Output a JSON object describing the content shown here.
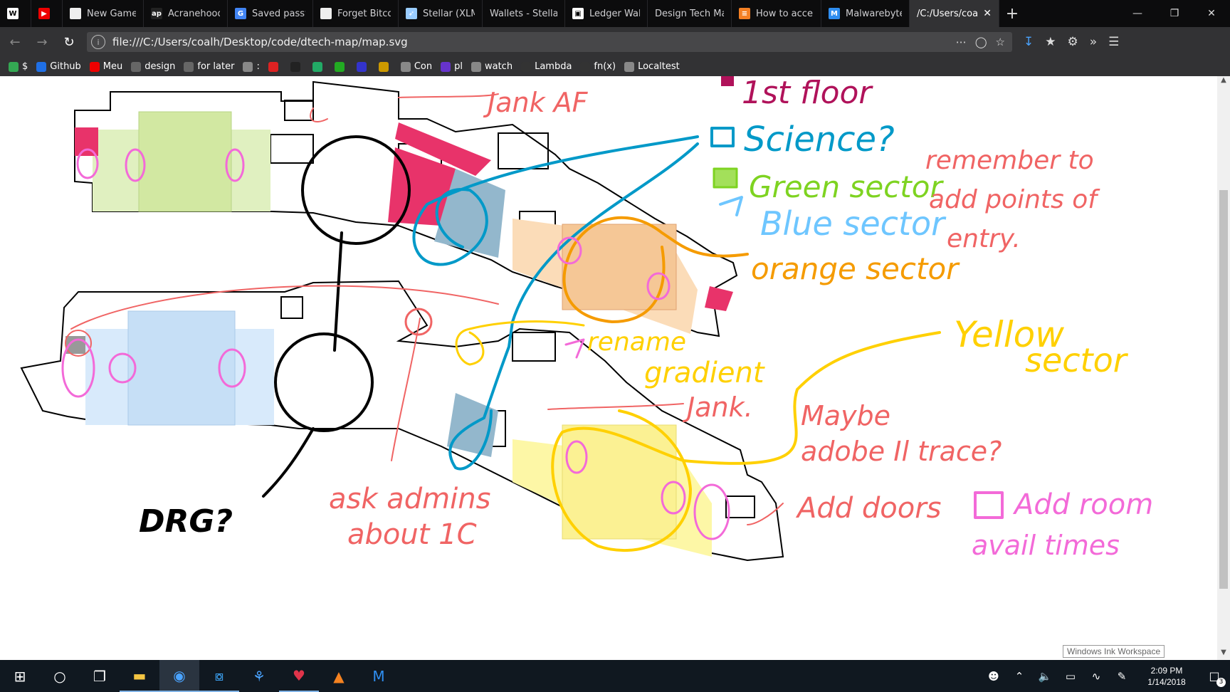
{
  "tabs": [
    {
      "label": "",
      "icon": "wikipedia-icon",
      "width": 44
    },
    {
      "label": "",
      "icon": "youtube-icon",
      "width": 44
    },
    {
      "label": "New Gamell",
      "icon": "page-icon",
      "width": 114
    },
    {
      "label": "Acranehood'",
      "icon": "ap-icon",
      "width": 118
    },
    {
      "label": "Saved passw",
      "icon": "google-icon",
      "width": 120
    },
    {
      "label": "Forget Bitcoi",
      "icon": "page-icon",
      "width": 120
    },
    {
      "label": "Stellar (XLM)",
      "icon": "rocket-icon",
      "width": 118
    },
    {
      "label": "Wallets - Stellar",
      "icon": "",
      "width": 116
    },
    {
      "label": "Ledger Walle",
      "icon": "ledger-icon",
      "width": 116
    },
    {
      "label": "Design Tech Map",
      "icon": "",
      "width": 118
    },
    {
      "label": "How to acce",
      "icon": "stackoverflow-icon",
      "width": 126
    },
    {
      "label": "Malwarebyte",
      "icon": "malwarebytes-icon",
      "width": 124
    },
    {
      "label": "/C:/Users/coal",
      "icon": "",
      "width": 126,
      "active": true
    }
  ],
  "window_controls": {
    "minimize": "—",
    "restore": "❐",
    "close": "✕"
  },
  "navbar": {
    "url": "file:///C:/Users/coalh/Desktop/code/dtech-map/map.svg",
    "info_glyph": "i"
  },
  "bookmarks": [
    {
      "label": "$",
      "icon": "drive-icon",
      "color": "#34a853"
    },
    {
      "label": "Github",
      "icon": "firefox-icon",
      "color": "#1f6fe5"
    },
    {
      "label": "Meu",
      "icon": "youtube-icon",
      "color": "#e00"
    },
    {
      "label": "design",
      "icon": "folder-icon",
      "color": "#666"
    },
    {
      "label": "for later",
      "icon": "folder-icon",
      "color": "#666"
    },
    {
      "label": ":",
      "icon": "globe-icon",
      "color": "#888"
    },
    {
      "label": "",
      "icon": "redcircle-icon",
      "color": "#d22"
    },
    {
      "label": "",
      "icon": "ap-icon",
      "color": "#222"
    },
    {
      "label": "",
      "icon": "blue-gear-icon",
      "color": "#2a6"
    },
    {
      "label": "",
      "icon": "green-icon",
      "color": "#2a2"
    },
    {
      "label": "",
      "icon": "blue-square-icon",
      "color": "#33c"
    },
    {
      "label": "",
      "icon": "p-icon",
      "color": "#c90"
    },
    {
      "label": "Con",
      "icon": "globe-icon",
      "color": "#888"
    },
    {
      "label": "pl",
      "icon": "purple-icon",
      "color": "#63c"
    },
    {
      "label": "watch",
      "icon": "globe-icon",
      "color": "#888"
    },
    {
      "label": "Lambda",
      "icon": "github-icon",
      "color": "#333"
    },
    {
      "label": "fn(x)",
      "icon": "github-icon",
      "color": "#333"
    },
    {
      "label": "Localtest",
      "icon": "globe-icon",
      "color": "#888"
    }
  ],
  "notes": {
    "jank_af": "Jank AF",
    "first_floor": "1st floor",
    "science": "Science?",
    "green": "Green sector",
    "blue": "Blue sector",
    "orange": "orange sector",
    "remember1": "remember to",
    "remember2": "add points of",
    "remember3": "entry.",
    "yellow1": "Yellow",
    "yellow2": "sector",
    "rename1": "rename",
    "rename2": "gradient",
    "jank": "Jank.",
    "maybe1": "Maybe",
    "maybe2": "adobe Il trace?",
    "add_doors": "Add doors",
    "add_room1": "Add room",
    "add_room2": "avail times",
    "ask1": "ask admins",
    "ask2": "about 1C",
    "drg": "DRG?"
  },
  "colors": {
    "first_floor": "#b0125a",
    "science": "#0099c8",
    "green": "#7ed321",
    "blue": "#6ec6ff",
    "orange": "#f59b00",
    "yellow": "#ffd000",
    "note_red": "#f06464",
    "pink": "#f36ad8",
    "black": "#000000",
    "green_fill": "#e0f0c0",
    "blue_fill": "#d8eafb",
    "orange_fill": "#fbdcb8",
    "yellow_fill": "#fdf7a6",
    "crimson_fill": "#e8336a",
    "steel_fill": "#93b7cc"
  },
  "ink_workspace": "Windows Ink Workspace",
  "taskbar": {
    "items": [
      "windows-icon",
      "search-icon",
      "taskview-icon",
      "file-explorer-icon",
      "firefox-icon",
      "vscode-icon",
      "dolphin-icon",
      "heart-icon",
      "vlc-icon",
      "malwarebytes-icon"
    ],
    "time": "2:09 PM",
    "date": "1/14/2018",
    "notifications": "3"
  }
}
